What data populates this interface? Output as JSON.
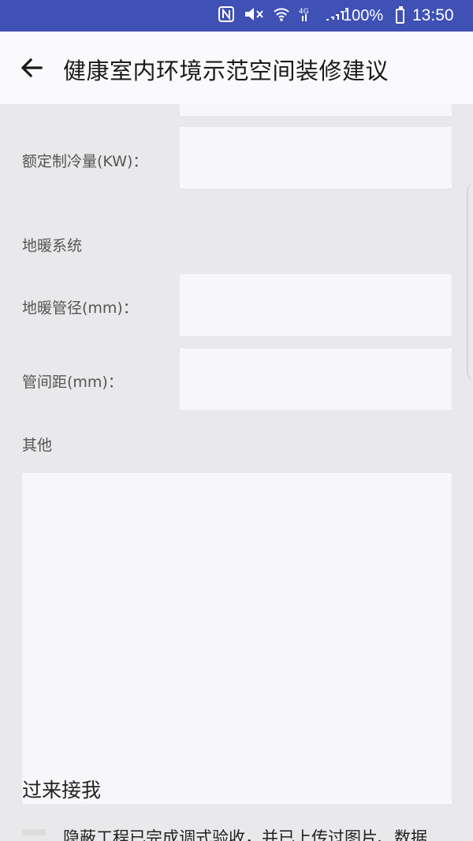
{
  "status_bar": {
    "icons": [
      "nfc-icon",
      "mute-icon",
      "wifi-icon",
      "signal-4g-icon",
      "signal-bars-icon"
    ],
    "battery": "100%",
    "time": "13:50",
    "background": "#3f51b5"
  },
  "app_bar": {
    "title": "健康室内环境示范空间装修建议"
  },
  "form": {
    "cooling_capacity_label": "额定制冷量(KW)：",
    "floor_heating_section": "地暖系统",
    "pipe_diameter_label": "地暖管径(mm)：",
    "pipe_spacing_label": "管间距(mm)：",
    "other_section": "其他",
    "cooling_capacity_value": "",
    "pipe_diameter_value": "",
    "pipe_spacing_value": "",
    "other_value": ""
  },
  "footer_section": {
    "heading": "过来接我",
    "text": "隐蔽工程已完成调式验收，并已上传过图片、数据"
  }
}
